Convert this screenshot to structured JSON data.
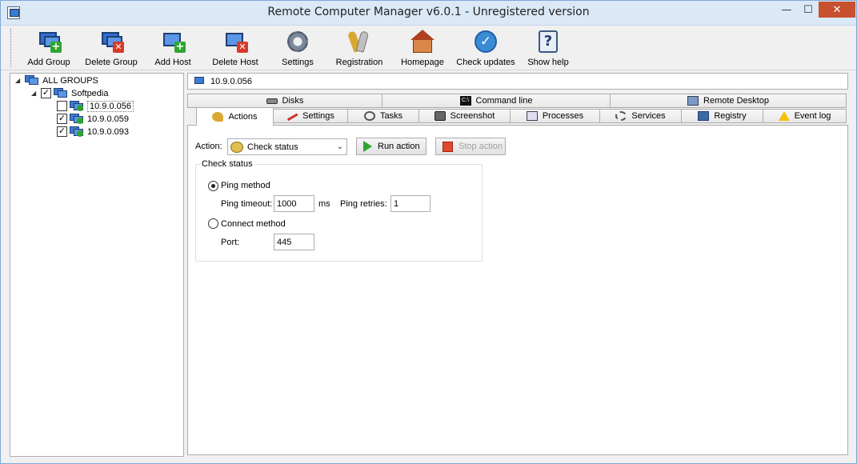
{
  "window": {
    "title": "Remote Computer Manager v6.0.1 - Unregistered version",
    "minimize": "—",
    "maximize": "☐",
    "close": "✕"
  },
  "toolbar": {
    "add_group": "Add Group",
    "delete_group": "Delete Group",
    "add_host": "Add Host",
    "delete_host": "Delete Host",
    "settings": "Settings",
    "registration": "Registration",
    "homepage": "Homepage",
    "check_updates": "Check updates",
    "show_help": "Show help"
  },
  "tree": {
    "root": "ALL GROUPS",
    "group": "Softpedia",
    "hosts": [
      {
        "label": "10.9.0.056",
        "checked": false
      },
      {
        "label": "10.9.0.059",
        "checked": true
      },
      {
        "label": "10.9.0.093",
        "checked": true
      }
    ]
  },
  "selected_host": "10.9.0.056",
  "tabs_row1": [
    "Disks",
    "Command line",
    "Remote Desktop"
  ],
  "tabs_row2": [
    "Actions",
    "Settings",
    "Tasks",
    "Screenshot",
    "Processes",
    "Services",
    "Registry",
    "Event log"
  ],
  "active_tab": "Actions",
  "actions": {
    "action_label": "Action:",
    "action_value": "Check status",
    "run_button": "Run action",
    "stop_button": "Stop action",
    "group_title": "Check status",
    "ping_method": "Ping method",
    "ping_timeout_label": "Ping timeout:",
    "ping_timeout_value": "1000",
    "ms_label": "ms",
    "ping_retries_label": "Ping retries:",
    "ping_retries_value": "1",
    "connect_method": "Connect method",
    "port_label": "Port:",
    "port_value": "445"
  }
}
